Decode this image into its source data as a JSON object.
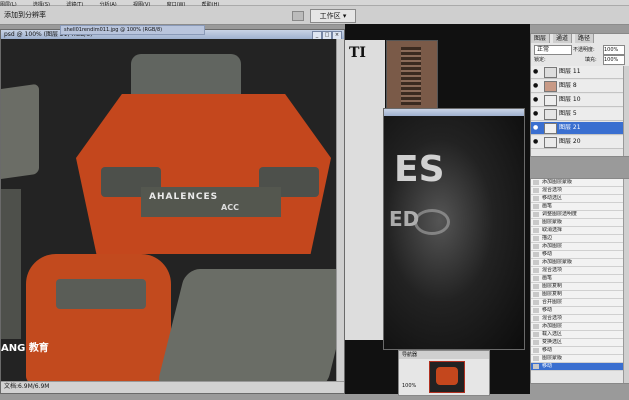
{
  "menubar": {
    "items": [
      "图层(L)",
      "选择(S)",
      "滤镜(T)",
      "分析(A)",
      "视图(V)",
      "窗口(W)",
      "帮助(H)"
    ]
  },
  "optbar": {
    "left_label": "添加到分辨率",
    "workspace": "工作区 ▾"
  },
  "main_window": {
    "title": "psd @ 100% (图层 21, RGB/8)",
    "tab2": "shell01rendim011.jpg @ 100% (RGB/8)",
    "status": "文档:6.9M/6.9M",
    "texture_text_1": "AHALENCES",
    "texture_text_2": "ACC"
  },
  "watermark": {
    "text": "ANG",
    "sub": "教育"
  },
  "layers_panel": {
    "tabs": [
      "图层",
      "通道",
      "路径"
    ],
    "blend_mode": "正常",
    "opacity_label": "不透明度:",
    "opacity_value": "100%",
    "fill_label": "填充:",
    "fill_value": "100%",
    "lock_label": "锁定:",
    "rows": [
      {
        "name": "图层 11",
        "selected": false
      },
      {
        "name": "图层 8",
        "selected": false
      },
      {
        "name": "图层 10",
        "selected": false
      },
      {
        "name": "图层 5",
        "selected": false
      },
      {
        "name": "图层 21",
        "selected": true
      },
      {
        "name": "图层 20",
        "selected": false
      }
    ]
  },
  "history_panel": {
    "items": [
      "添加图层蒙版",
      "混合选项",
      "移动选区",
      "画笔",
      "调整图层透明度",
      "图层蒙版",
      "取消选择",
      "描边",
      "添加图层",
      "移动",
      "添加图层蒙版",
      "混合选项",
      "画笔",
      "图层复制",
      "图层复制",
      "合并图层",
      "移动",
      "混合选项",
      "添加图层",
      "载入选区",
      "变换选区",
      "移动",
      "图层蒙版",
      "移动"
    ],
    "selected_index": 23
  },
  "navigator": {
    "title": "导航器",
    "zoom": "100%"
  }
}
